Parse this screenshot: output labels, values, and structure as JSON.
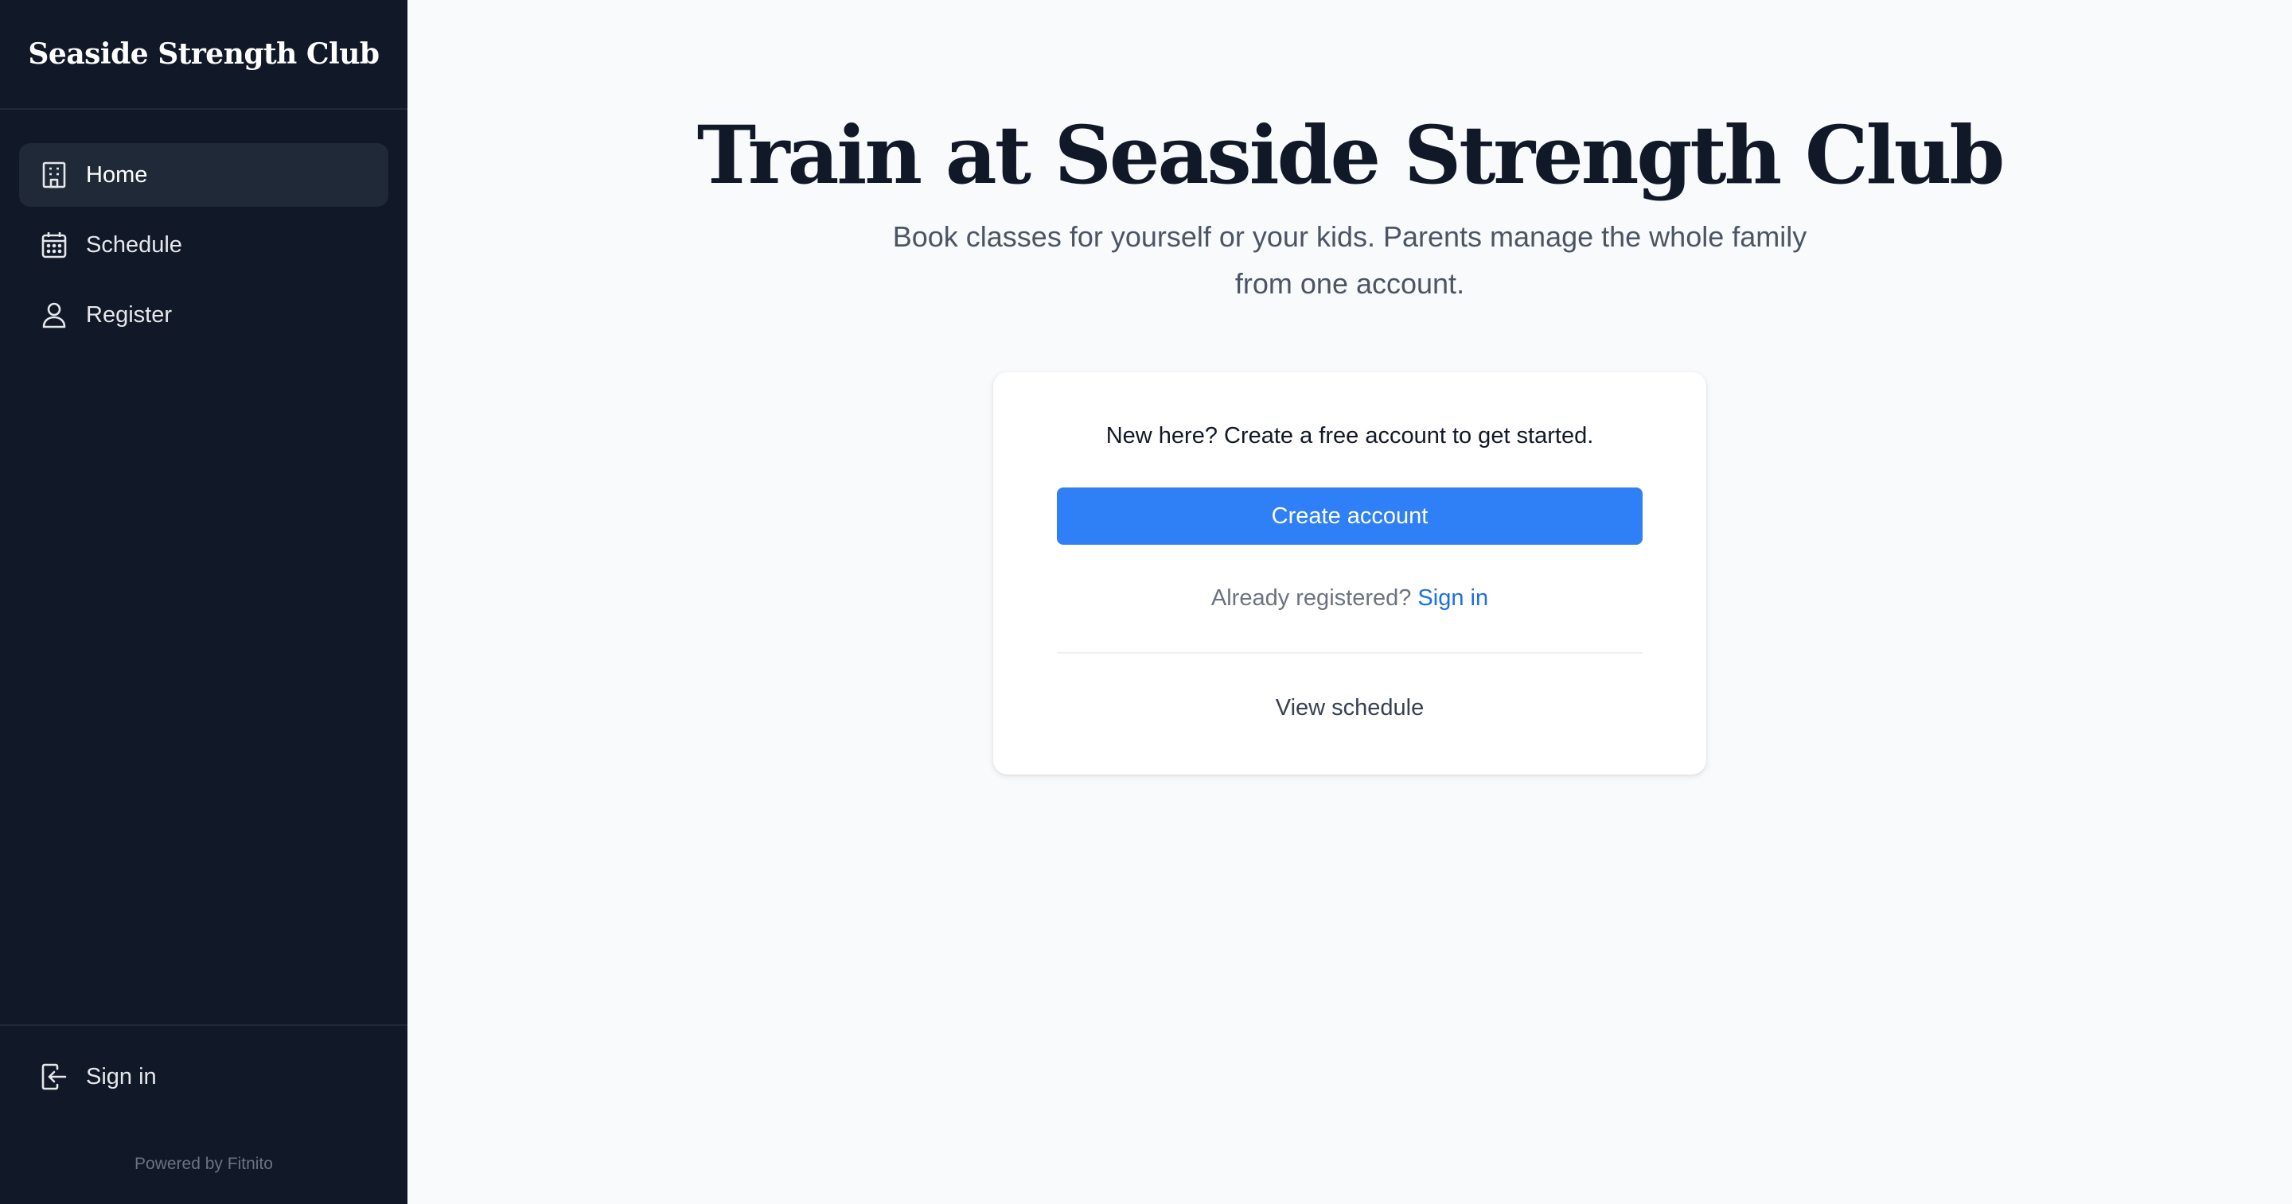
{
  "sidebar": {
    "brand": "Seaside Strength Club",
    "items": [
      {
        "label": "Home",
        "icon": "building-icon",
        "active": true
      },
      {
        "label": "Schedule",
        "icon": "calendar-icon",
        "active": false
      },
      {
        "label": "Register",
        "icon": "user-icon",
        "active": false
      }
    ],
    "bottom": {
      "sign_in_label": "Sign in",
      "sign_in_icon": "sign-in-icon",
      "powered_by": "Powered by Fitnito"
    }
  },
  "main": {
    "title": "Train at Seaside Strength Club",
    "subtitle": "Book classes for yourself or your kids. Parents manage the whole family from one account.",
    "card": {
      "intro": "New here? Create a free account to get started.",
      "create_button": "Create account",
      "already_registered": "Already registered?",
      "sign_in_link": "Sign in",
      "view_schedule": "View schedule"
    }
  },
  "colors": {
    "sidebar_bg": "#111827",
    "active_item_bg": "#1f2937",
    "primary_button": "#2f80f7",
    "link": "#1d6fe6",
    "page_bg": "#f8fafc"
  }
}
